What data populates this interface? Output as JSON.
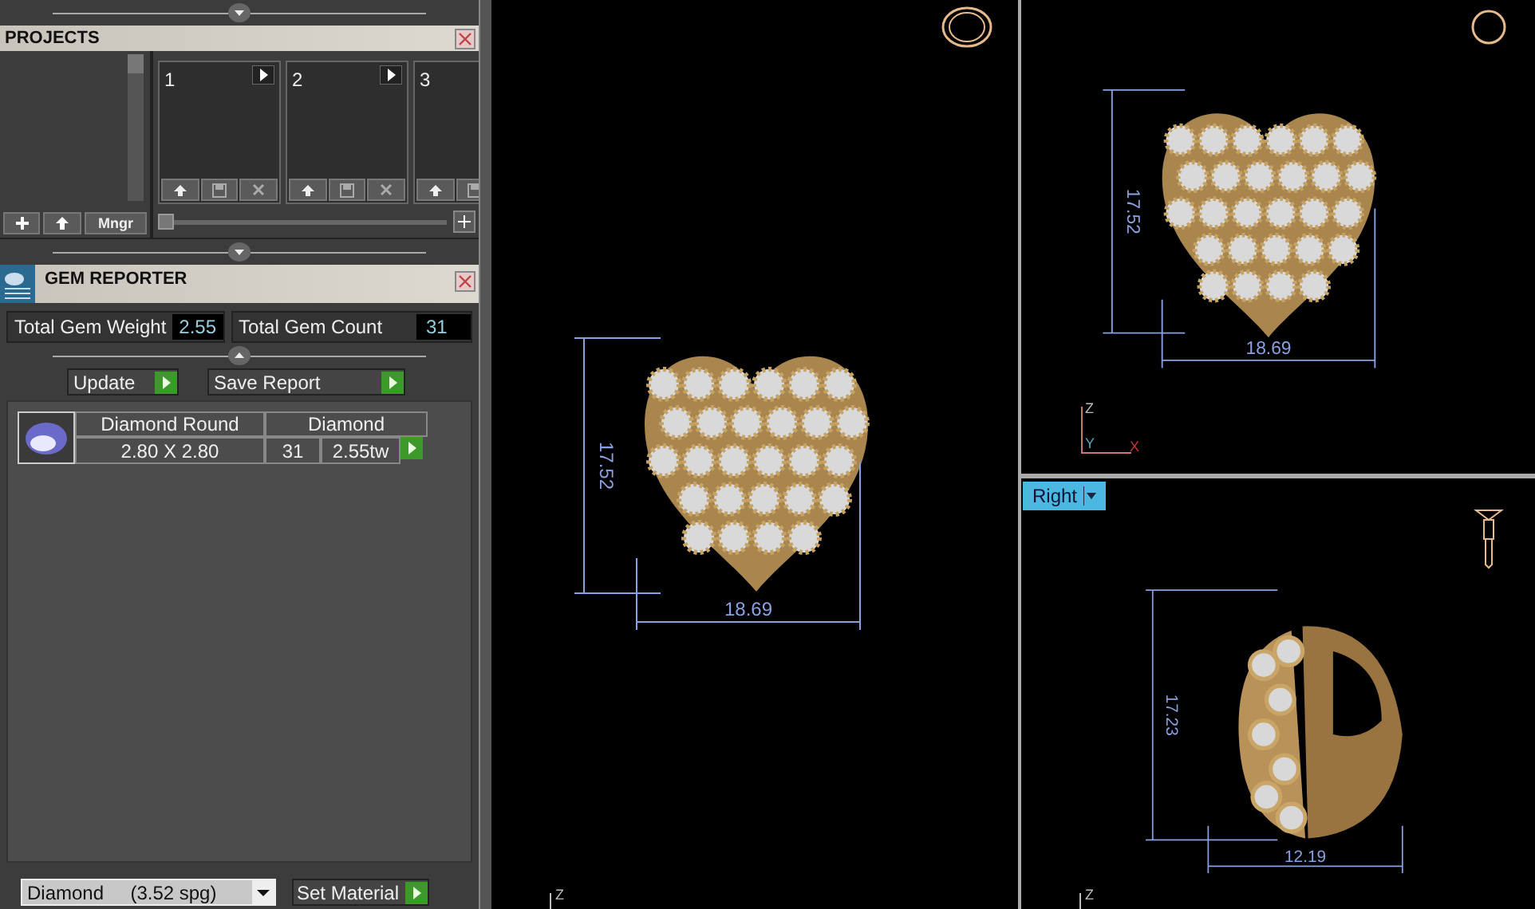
{
  "projects_panel": {
    "title": "PROJECTS",
    "slots": [
      {
        "label": "1"
      },
      {
        "label": "2"
      },
      {
        "label": "3"
      }
    ],
    "manager_button": "Mngr",
    "zoom_slider": {
      "level": 0
    }
  },
  "gem_reporter": {
    "title": "GEM REPORTER",
    "total_weight_label": "Total Gem Weight",
    "total_weight": "2.55",
    "total_count_label": "Total Gem Count",
    "total_count": "31",
    "actions": [
      "Update",
      "Save Report"
    ],
    "gems": [
      {
        "shape": "Diamond Round",
        "size": "2.80 X 2.80",
        "material": "Diamond",
        "count": "31",
        "weight": "2.55tw"
      }
    ]
  },
  "material_select": {
    "value": "Diamond     (3.52 spg)"
  },
  "set_material_button": "Set Material",
  "viewports": [
    {
      "kind": "perspective",
      "height_dim": "17.52",
      "width_dim": "18.69",
      "axes": [
        "Z"
      ]
    },
    {
      "kind": "front",
      "height_dim": "17.52",
      "width_dim": "18.69",
      "axes": [
        "Z",
        "Y",
        "X"
      ]
    },
    {
      "kind": "right",
      "view_label": "Right",
      "height_dim": "17.23",
      "width_dim": "12.19",
      "axes": [
        "Z"
      ]
    }
  ]
}
